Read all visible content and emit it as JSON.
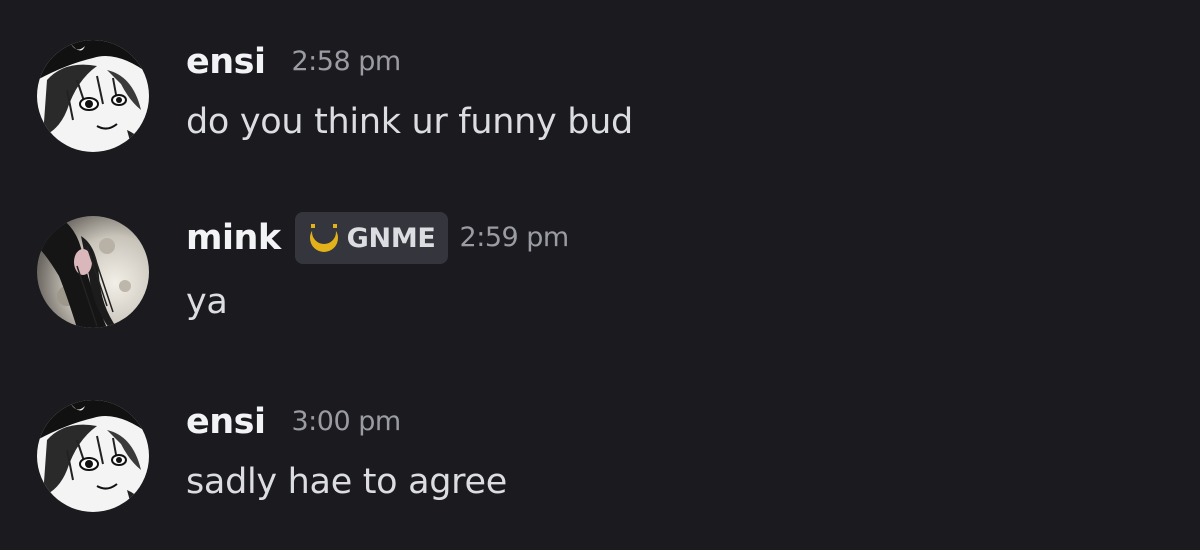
{
  "messages": [
    {
      "username": "ensi",
      "timestamp": "2:58 pm",
      "text": "do you think ur funny bud",
      "avatar_icon": "manga-girl-avatar"
    },
    {
      "username": "mink",
      "tag": {
        "icon": "crescent-moon-icon",
        "label": "GNME",
        "color": "#e3b21a"
      },
      "timestamp": "2:59 pm",
      "text": "ya",
      "avatar_icon": "moon-girl-avatar"
    },
    {
      "username": "ensi",
      "timestamp": "3:00 pm",
      "text": "sadly hae to agree",
      "avatar_icon": "manga-girl-avatar"
    }
  ],
  "colors": {
    "background": "#1b1b1f",
    "username": "#f2f3f5",
    "message_text": "#dbdde1",
    "timestamp": "#9a9ba3",
    "tag_background": "#35363d"
  }
}
